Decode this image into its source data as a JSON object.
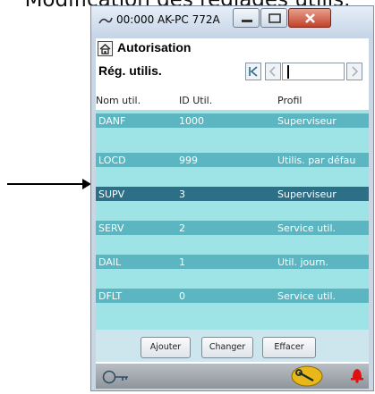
{
  "caption": "Modification des réglages utilis.",
  "window": {
    "title": "00:000 AK-PC 772A"
  },
  "screen": {
    "title": "Autorisation",
    "subtitle": "Rég. utilis."
  },
  "table": {
    "columns": [
      "Nom util.",
      "ID Util.",
      "Profil"
    ],
    "rows": [
      {
        "name": "DANF",
        "id": "1000",
        "profile": "Superviseur",
        "selected": false
      },
      {
        "name": "LOCD",
        "id": "999",
        "profile": "Utilis. par défau",
        "selected": false
      },
      {
        "name": "SUPV",
        "id": "3",
        "profile": "Superviseur",
        "selected": true
      },
      {
        "name": "SERV",
        "id": "2",
        "profile": "Service util.",
        "selected": false
      },
      {
        "name": "DAIL",
        "id": "1",
        "profile": "Util. journ.",
        "selected": false
      },
      {
        "name": "DFLT",
        "id": "0",
        "profile": "Service util.",
        "selected": false
      }
    ]
  },
  "actions": {
    "add": "Ajouter",
    "change": "Changer",
    "delete": "Effacer"
  },
  "colors": {
    "row_normal": "#5cb6c1",
    "row_selected": "#2c6f87",
    "list_background": "#9ee4e6",
    "alarm": "#e01010"
  },
  "icons": {
    "home": "home-icon",
    "key": "key-icon",
    "wrench": "wrench-icon",
    "alarm": "alarm-bell-icon"
  }
}
